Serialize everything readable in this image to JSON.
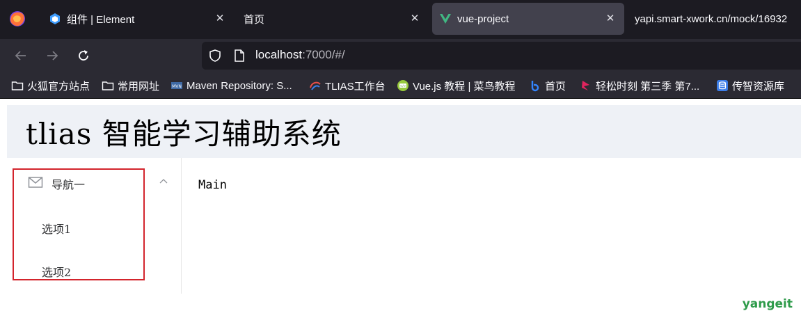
{
  "browser": {
    "tabs": [
      {
        "label": "组件 | Element",
        "icon": "element-favicon-icon",
        "active": false
      },
      {
        "label": "首页",
        "icon": "",
        "active": false
      },
      {
        "label": "vue-project",
        "icon": "vue-favicon-icon",
        "active": true
      },
      {
        "label": "yapi.smart-xwork.cn/mock/16932",
        "icon": "",
        "active": false
      }
    ],
    "url": {
      "host": "localhost",
      "rest": ":7000/#/"
    },
    "bookmarks": [
      {
        "label": "火狐官方站点",
        "icon": "folder-icon"
      },
      {
        "label": "常用网址",
        "icon": "folder-icon"
      },
      {
        "label": "Maven Repository: S...",
        "icon": "maven-icon"
      },
      {
        "label": "TLIAS工作台",
        "icon": "tlias-icon"
      },
      {
        "label": "Vue.js 教程 | 菜鸟教程",
        "icon": "runoob-icon"
      },
      {
        "label": "首页",
        "icon": "baidu-icon"
      },
      {
        "label": "轻松时刻 第三季 第7...",
        "icon": "video-icon"
      },
      {
        "label": "传智资源库",
        "icon": "database-icon"
      }
    ]
  },
  "app": {
    "title": "tlias 智能学习辅助系统",
    "menu": {
      "group_label": "导航一",
      "items": [
        "选项1",
        "选项2"
      ]
    },
    "main_text": "Main"
  },
  "watermark": "yangeit",
  "colors": {
    "header_bg": "#eef1f6",
    "highlight_border": "#d3242c",
    "tabstrip_bg": "#1c1b22",
    "toolbar_bg": "#2b2a33"
  }
}
